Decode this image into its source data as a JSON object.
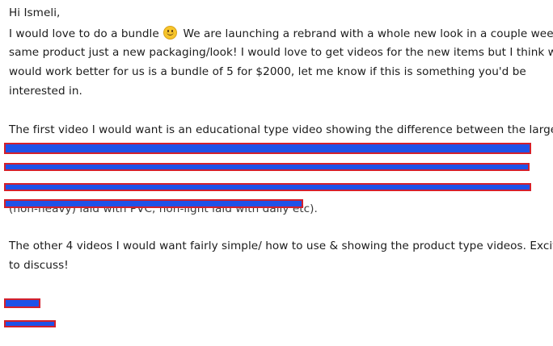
{
  "email": {
    "greeting": "Hi Ismeli,",
    "para1": {
      "line1_before_emoji": "I would love to do a bundle",
      "emoji": "slightly-smiling-face",
      "line1_after_emoji": "We are launching a rebrand with a whole new look in a couple weeks,",
      "line2": "same product just a new packaging/look! I would love to get videos for the new items but I think what",
      "line3": "would work better for us is a bundle of 5 for $2000, let me know if this is something you'd be",
      "line4": "interested in."
    },
    "para2": {
      "line1": "The first video I would want is an educational type video showing the difference between the larger",
      "line5_partial": "(non-heavy) laid with PVC, non-light laid with daily etc)."
    },
    "para3": {
      "line1": "The other 4 videos I would want fairly simple/ how to use & showing the product type videos. Excited",
      "line2": "to discuss!"
    },
    "redaction_colors": {
      "fill": "#1f52e8",
      "border": "#d3202c"
    }
  }
}
